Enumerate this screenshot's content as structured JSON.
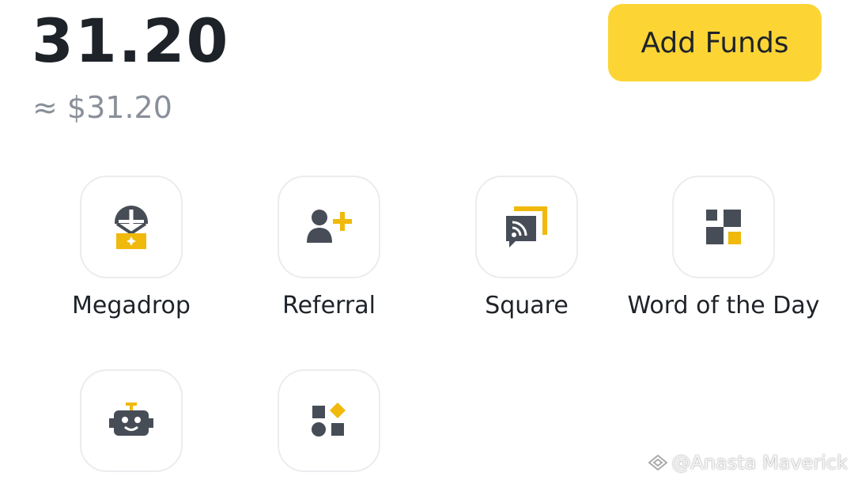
{
  "balance": {
    "amount": "31.20",
    "fiat_equivalent": "≈ $31.20"
  },
  "actions": {
    "add_funds_label": "Add Funds"
  },
  "shortcuts": [
    {
      "label": "Megadrop",
      "icon": "megadrop-icon"
    },
    {
      "label": "Referral",
      "icon": "referral-icon"
    },
    {
      "label": "Square",
      "icon": "square-feed-icon"
    },
    {
      "label": "Word of the Day",
      "icon": "word-of-the-day-icon"
    },
    {
      "label": "",
      "icon": "robot-icon"
    },
    {
      "label": "",
      "icon": "more-shapes-icon"
    }
  ],
  "watermark": {
    "text": "@Anasta Maverick"
  },
  "colors": {
    "accent": "#fcd535",
    "icon_dark": "#474d57",
    "icon_yellow": "#f0b90b",
    "text_primary": "#1e2329",
    "text_secondary": "#8a9099"
  }
}
